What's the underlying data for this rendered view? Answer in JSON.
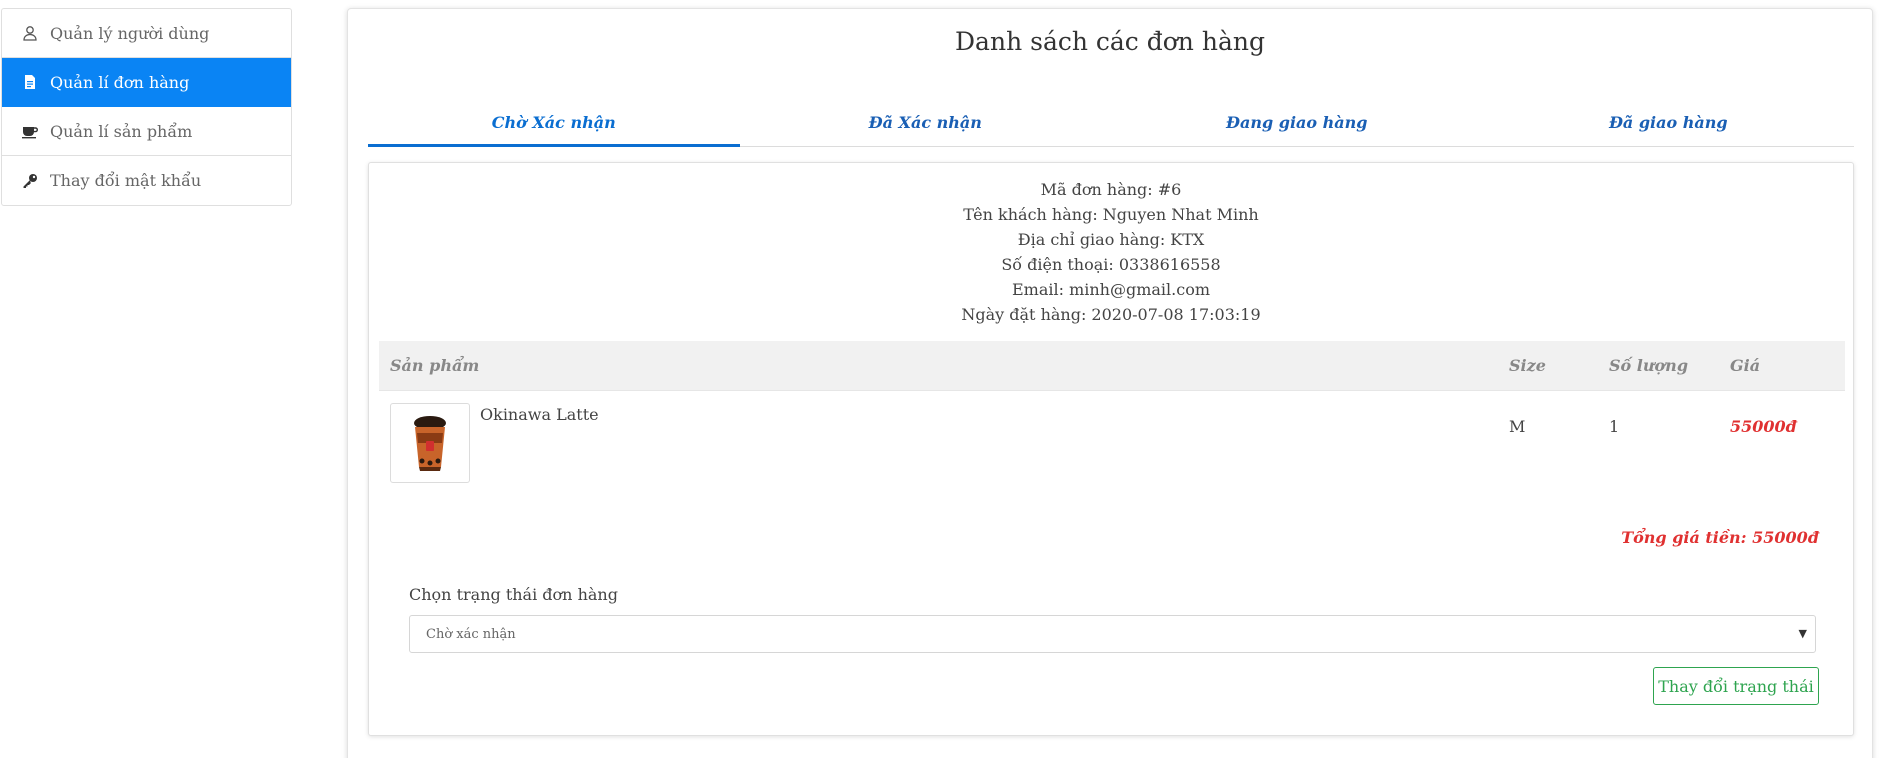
{
  "sidebar": {
    "items": [
      {
        "label": "Quản lý người dùng",
        "icon": "user-icon"
      },
      {
        "label": "Quản lí đơn hàng",
        "icon": "document-icon"
      },
      {
        "label": "Quản lí sản phẩm",
        "icon": "coffee-cup-icon"
      },
      {
        "label": "Thay đổi mật khẩu",
        "icon": "key-icon"
      }
    ],
    "active_index": 1
  },
  "main": {
    "title": "Danh sách các đơn hàng",
    "tabs": [
      {
        "label": "Chờ Xác nhận"
      },
      {
        "label": "Đã Xác nhận"
      },
      {
        "label": "Đang giao hàng"
      },
      {
        "label": "Đã giao hàng"
      }
    ],
    "active_tab": 0
  },
  "order": {
    "id_line": "Mã đơn hàng: #6",
    "customer_line": "Tên khách hàng: Nguyen Nhat Minh",
    "address_line": "Địa chỉ giao hàng: KTX",
    "phone_line": "Số điện thoại: 0338616558",
    "email_line": "Email: minh@gmail.com",
    "date_line": "Ngày đặt hàng: 2020-07-08 17:03:19",
    "table": {
      "headers": {
        "product": "Sản phẩm",
        "size": "Size",
        "quantity": "Số lượng",
        "price": "Giá"
      },
      "rows": [
        {
          "product": "Okinawa Latte",
          "size": "M",
          "quantity": "1",
          "price": "55000đ"
        }
      ]
    },
    "total": "Tổng giá tiền: 55000đ",
    "status_label": "Chọn trạng thái đơn hàng",
    "status_selected": "Chờ xác nhận",
    "change_button": "Thay đổi trạng thái"
  },
  "colors": {
    "accent": "#0a84f4",
    "tab_blue": "#1a5fb4",
    "price_red": "#e03131",
    "button_green": "#2ea44f"
  }
}
